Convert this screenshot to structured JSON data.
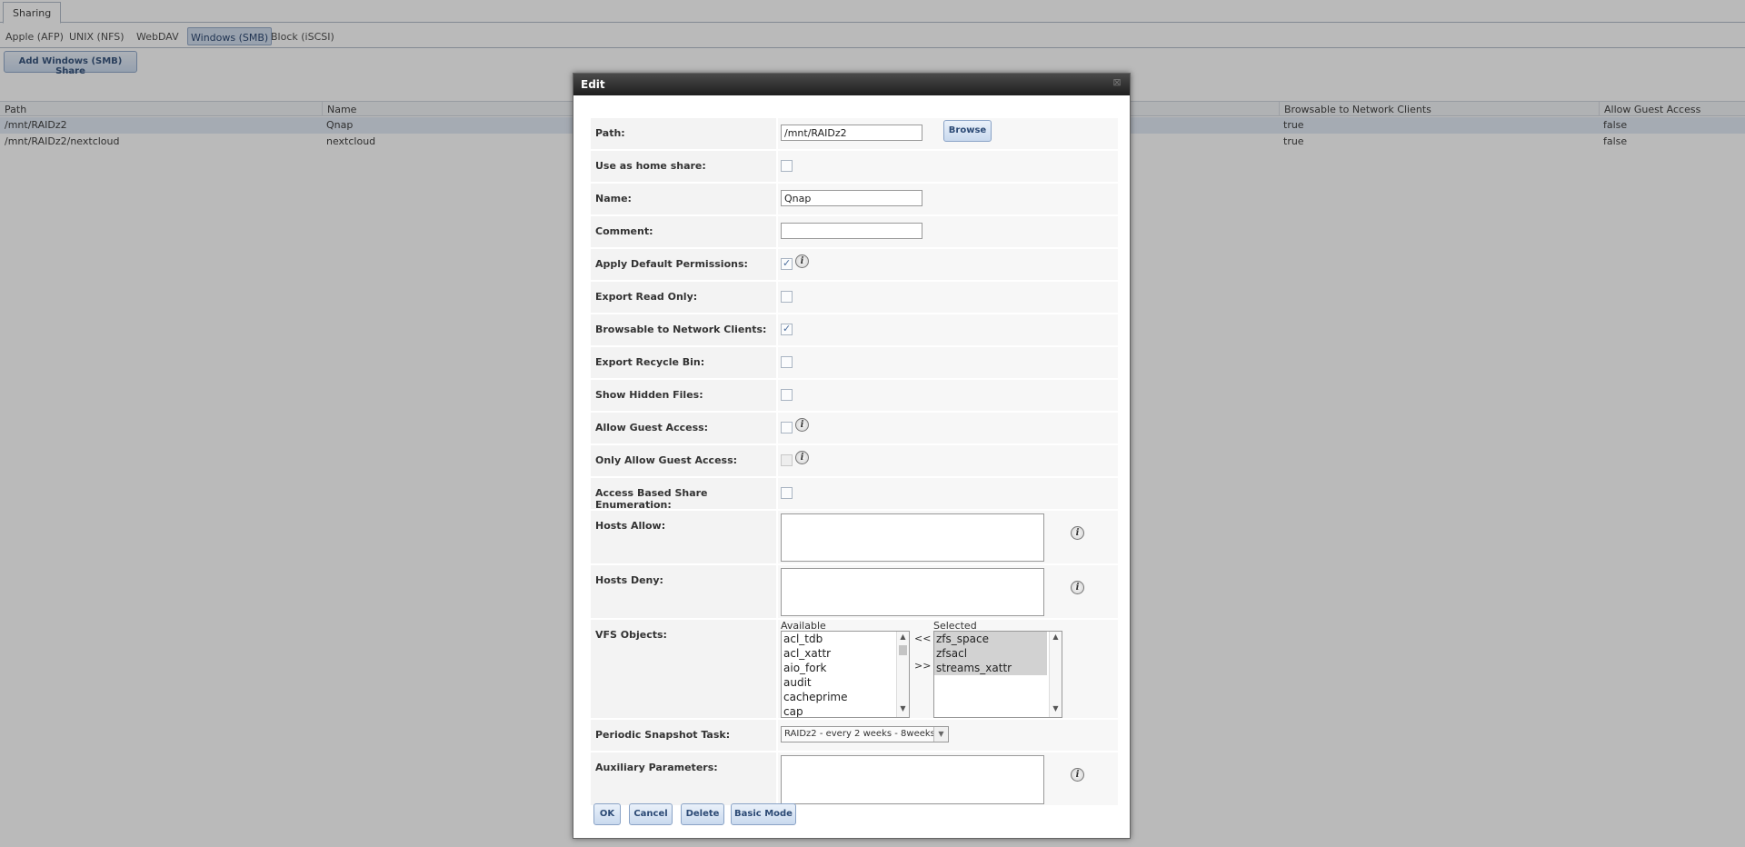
{
  "tabs": {
    "sharing": "Sharing"
  },
  "subnav": [
    "Apple (AFP)",
    "UNIX (NFS)",
    "WebDAV",
    "Windows (SMB)",
    "Block (iSCSI)"
  ],
  "add_button": "Add Windows (SMB) Share",
  "grid": {
    "columns": [
      "Path",
      "Name",
      "Browsable to Network Clients",
      "Allow Guest Access"
    ],
    "rows": [
      {
        "path": "/mnt/RAIDz2",
        "name": "Qnap",
        "browsable": "true",
        "guest": "false"
      },
      {
        "path": "/mnt/RAIDz2/nextcloud",
        "name": "nextcloud",
        "browsable": "true",
        "guest": "false"
      }
    ]
  },
  "dialog": {
    "title": "Edit",
    "fields": {
      "path": {
        "label": "Path:",
        "value": "/mnt/RAIDz2",
        "browse": "Browse"
      },
      "home_share": {
        "label": "Use as home share:"
      },
      "name": {
        "label": "Name:",
        "value": "Qnap"
      },
      "comment": {
        "label": "Comment:",
        "value": ""
      },
      "default_perms": {
        "label": "Apply Default Permissions:"
      },
      "read_only": {
        "label": "Export Read Only:"
      },
      "browsable": {
        "label": "Browsable to Network Clients:"
      },
      "recycle": {
        "label": "Export Recycle Bin:"
      },
      "hidden": {
        "label": "Show Hidden Files:"
      },
      "guest": {
        "label": "Allow Guest Access:"
      },
      "guest_only": {
        "label": "Only Allow Guest Access:"
      },
      "abe": {
        "label": "Access Based Share Enumeration:"
      },
      "hosts_allow": {
        "label": "Hosts Allow:"
      },
      "hosts_deny": {
        "label": "Hosts Deny:"
      },
      "vfs": {
        "label": "VFS Objects:",
        "available_caption": "Available",
        "selected_caption": "Selected",
        "available": [
          "acl_tdb",
          "acl_xattr",
          "aio_fork",
          "audit",
          "cacheprime",
          "cap"
        ],
        "selected": [
          "zfs_space",
          "zfsacl",
          "streams_xattr"
        ],
        "move_left": "<<",
        "move_right": ">>"
      },
      "snapshot": {
        "label": "Periodic Snapshot Task:",
        "value": "RAIDz2 - every 2 weeks - 8weeks"
      },
      "aux": {
        "label": "Auxiliary Parameters:"
      }
    },
    "buttons": {
      "ok": "OK",
      "cancel": "Cancel",
      "delete": "Delete",
      "basic": "Basic Mode"
    }
  }
}
